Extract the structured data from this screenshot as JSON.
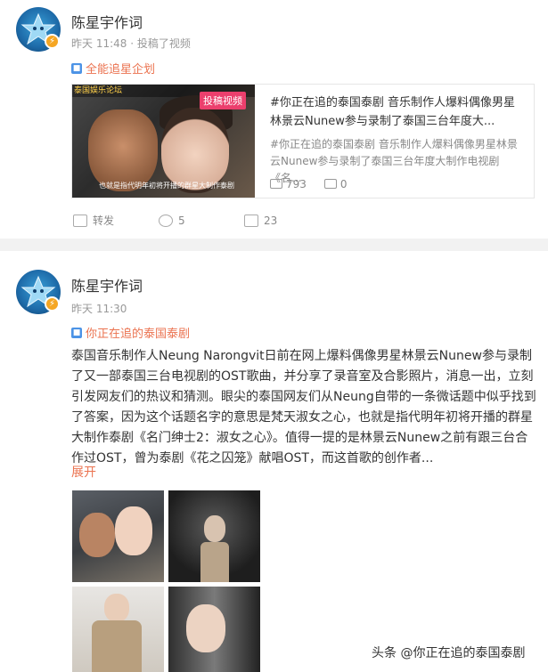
{
  "post1": {
    "username": "陈星宇作词",
    "time": "昨天 11:48",
    "action": "投稿了视频",
    "topic": "全能追星企划",
    "video": {
      "banner": "泰国娱乐论坛",
      "tag": "投稿视频",
      "caption": "也就是指代明年初将开播的群星大制作泰剧",
      "title": "#你正在追的泰国泰剧 音乐制作人爆料偶像男星林景云Nunew参与录制了泰国三台年度大...",
      "desc": "#你正在追的泰国泰剧 音乐制作人爆料偶像男星林景云Nunew参与录制了泰国三台年度大制作电视剧《名...",
      "plays": "793",
      "comments": "0"
    },
    "actions": {
      "repost": "转发",
      "comments": "5",
      "likes": "23"
    }
  },
  "post2": {
    "username": "陈星宇作词",
    "time": "昨天 11:30",
    "topic": "你正在追的泰国泰剧",
    "text": "泰国音乐制作人Neung Narongvit日前在网上爆料偶像男星林景云Nunew参与录制了又一部泰国三台电视剧的OST歌曲，并分享了录音室及合影照片，消息一出，立刻引发网友们的热议和猜测。眼尖的泰国网友们从Neung自带的一条微话题中似乎找到了答案，因为这个话题名字的意思是梵天淑女之心，也就是指代明年初将开播的群星大制作泰剧《名门绅士2：淑女之心》。值得一提的是林景云Nunew之前有跟三台合作过OST，曾为泰剧《花之囚笼》献唱OST，而这首歌的创作者...",
    "expand": "展开"
  },
  "watermark": "头条 @你正在追的泰国泰剧",
  "colors": {
    "accent": "#eb7350",
    "topic_icon": "#4c93e6",
    "badge": "#f5a623",
    "tag": "#eb3f6d"
  }
}
